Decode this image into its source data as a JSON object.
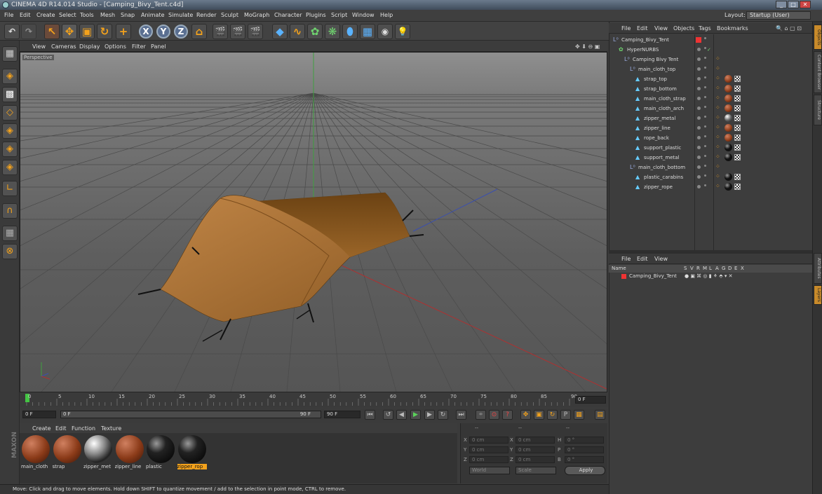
{
  "window": {
    "title": "CINEMA 4D R14.014 Studio - [Camping_Bivy_Tent.c4d]",
    "min": "_",
    "max": "□",
    "close": "✕"
  },
  "menubar": {
    "items": [
      "File",
      "Edit",
      "Create",
      "Select",
      "Tools",
      "Mesh",
      "Snap",
      "Animate",
      "Simulate",
      "Render",
      "Sculpt",
      "MoGraph",
      "Character",
      "Plugins",
      "Script",
      "Window",
      "Help"
    ],
    "layout_label": "Layout:",
    "layout_value": "Startup (User)"
  },
  "viewport": {
    "menu": [
      "View",
      "Cameras",
      "Display",
      "Options",
      "Filter",
      "Panel"
    ],
    "label": "Perspective"
  },
  "timeline": {
    "ticks": [
      "0",
      "5",
      "10",
      "15",
      "20",
      "25",
      "30",
      "35",
      "40",
      "45",
      "50",
      "55",
      "60",
      "65",
      "70",
      "75",
      "80",
      "85",
      "90"
    ],
    "current_frame_box": "0 F",
    "start_field": "0 F",
    "slider_start": "0 F",
    "slider_end": "90 F",
    "end_field": "90 F"
  },
  "materials": {
    "menu": [
      "Create",
      "Edit",
      "Function",
      "Texture"
    ],
    "items": [
      {
        "name": "main_cloth",
        "kind": "fabric"
      },
      {
        "name": "strap",
        "kind": "fabric"
      },
      {
        "name": "zipper_met",
        "kind": "chrome"
      },
      {
        "name": "zipper_line",
        "kind": "fabric"
      },
      {
        "name": "plastic",
        "kind": "black"
      },
      {
        "name": "zipper_rop",
        "kind": "black",
        "selected": true
      }
    ]
  },
  "coordinates": {
    "header": [
      "--",
      "--",
      "--"
    ],
    "rows": [
      {
        "a": "X",
        "av": "0 cm",
        "b": "X",
        "bv": "0 cm",
        "c": "H",
        "cv": "0 °"
      },
      {
        "a": "Y",
        "av": "0 cm",
        "b": "Y",
        "bv": "0 cm",
        "c": "P",
        "cv": "0 °"
      },
      {
        "a": "Z",
        "av": "0 cm",
        "b": "Z",
        "bv": "0 cm",
        "c": "B",
        "cv": "0 °"
      }
    ],
    "mode1": "World",
    "mode2": "Scale",
    "apply": "Apply"
  },
  "status": "Move: Click and drag to move elements. Hold down SHIFT to quantize movement / add to the selection in point mode, CTRL to remove.",
  "objects": {
    "menu": [
      "File",
      "Edit",
      "View",
      "Objects",
      "Tags",
      "Bookmarks"
    ],
    "rows": [
      {
        "name": "Camping_Bivy_Tent",
        "indent": 0,
        "icon": "null",
        "tags": "red"
      },
      {
        "name": "HyperNURBS",
        "indent": 1,
        "icon": "nurbs",
        "tags": "check"
      },
      {
        "name": "Camping Bivy Tent",
        "indent": 2,
        "icon": "null",
        "tags": "phong"
      },
      {
        "name": "main_cloth_top",
        "indent": 3,
        "icon": "null",
        "tags": "phong"
      },
      {
        "name": "strap_top",
        "indent": 4,
        "icon": "poly",
        "tags": "fabric"
      },
      {
        "name": "strap_bottom",
        "indent": 4,
        "icon": "poly",
        "tags": "fabric"
      },
      {
        "name": "main_cloth_strap",
        "indent": 4,
        "icon": "poly",
        "tags": "fabric"
      },
      {
        "name": "main_cloth_arch",
        "indent": 4,
        "icon": "poly",
        "tags": "fabric"
      },
      {
        "name": "zipper_metal",
        "indent": 4,
        "icon": "poly",
        "tags": "chrome"
      },
      {
        "name": "zipper_line",
        "indent": 4,
        "icon": "poly",
        "tags": "fabric"
      },
      {
        "name": "rope_back",
        "indent": 4,
        "icon": "poly",
        "tags": "fabric"
      },
      {
        "name": "support_plastic",
        "indent": 4,
        "icon": "poly",
        "tags": "black"
      },
      {
        "name": "support_metal",
        "indent": 4,
        "icon": "poly",
        "tags": "black"
      },
      {
        "name": "main_cloth_bottom",
        "indent": 3,
        "icon": "null",
        "tags": "phong"
      },
      {
        "name": "plastic_carabins",
        "indent": 4,
        "icon": "poly",
        "tags": "black"
      },
      {
        "name": "zipper_rope",
        "indent": 4,
        "icon": "poly",
        "tags": "black"
      }
    ]
  },
  "layers": {
    "menu": [
      "File",
      "Edit",
      "View"
    ],
    "header_name": "Name",
    "header_cols": [
      "S",
      "V",
      "R",
      "M",
      "L",
      "A",
      "G",
      "D",
      "E",
      "X"
    ],
    "row_name": "Camping_Bivy_Tent"
  },
  "side_tabs": [
    "Objects",
    "Content Browser",
    "Structure",
    "Attributes",
    "Layers"
  ],
  "colors": {
    "accent": "#f3a21c",
    "tent": "#a8702f",
    "selection": "#f3a21c"
  }
}
